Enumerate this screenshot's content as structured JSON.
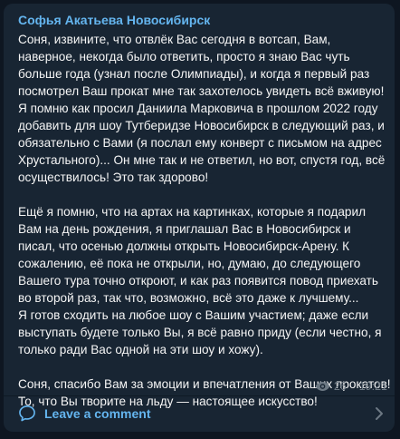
{
  "message": {
    "sender_name": "Софья Акатьева Новосибирск",
    "text": "Соня, извините, что отвлёк Вас сегодня в вотсап, Вам, наверное, некогда было ответить, просто я знаю Вас чуть больше года (узнал после Олимпиады), и когда я первый раз посмотрел Ваш прокат мне так захотелось увидеть всё вживую! Я помню как просил Даниила Марковича в прошлом 2022 году добавить для шоу Тутберидзе Новосибирск в следующий раз, и обязательно с Вами (я послал ему конверт с письмом на адрес Хрустального)... Он мне так и не ответил, но вот, спустя год, всё осуществилось! Это так здорово!\n\nЕщё я помню, что на артах на картинках, которые я подарил Вам на день рождения, я приглашал Вас в Новосибирск и писал, что осенью должны открыть Новосибирск-Арену. К сожалению, её пока не открыли, но, думаю, до следующего Вашего тура точно откроют, и как раз появится повод приехать во второй раз, так что, возможно, всё это даже к лучшему...\nЯ готов сходить на любое шоу с Вашим участием; даже если выступать будете только Вы, я всё равно приду (если честно, я только ради Вас одной на эти шоу и хожу).\n\nСоня, спасибо Вам за эмоции и впечатления от Ваших прокатов! То, что Вы творите на льду — настоящее искусство!",
    "views": "26",
    "time": "19:21"
  },
  "comments": {
    "label": "Leave a comment"
  },
  "icons": {
    "views": "eye-icon",
    "comment": "comment-icon",
    "open": "chevron-right-icon"
  },
  "colors": {
    "background": "#0e1621",
    "bubble": "#182533",
    "accent": "#64b5ef",
    "text": "#f5f5f5",
    "meta": "#6c7883"
  }
}
